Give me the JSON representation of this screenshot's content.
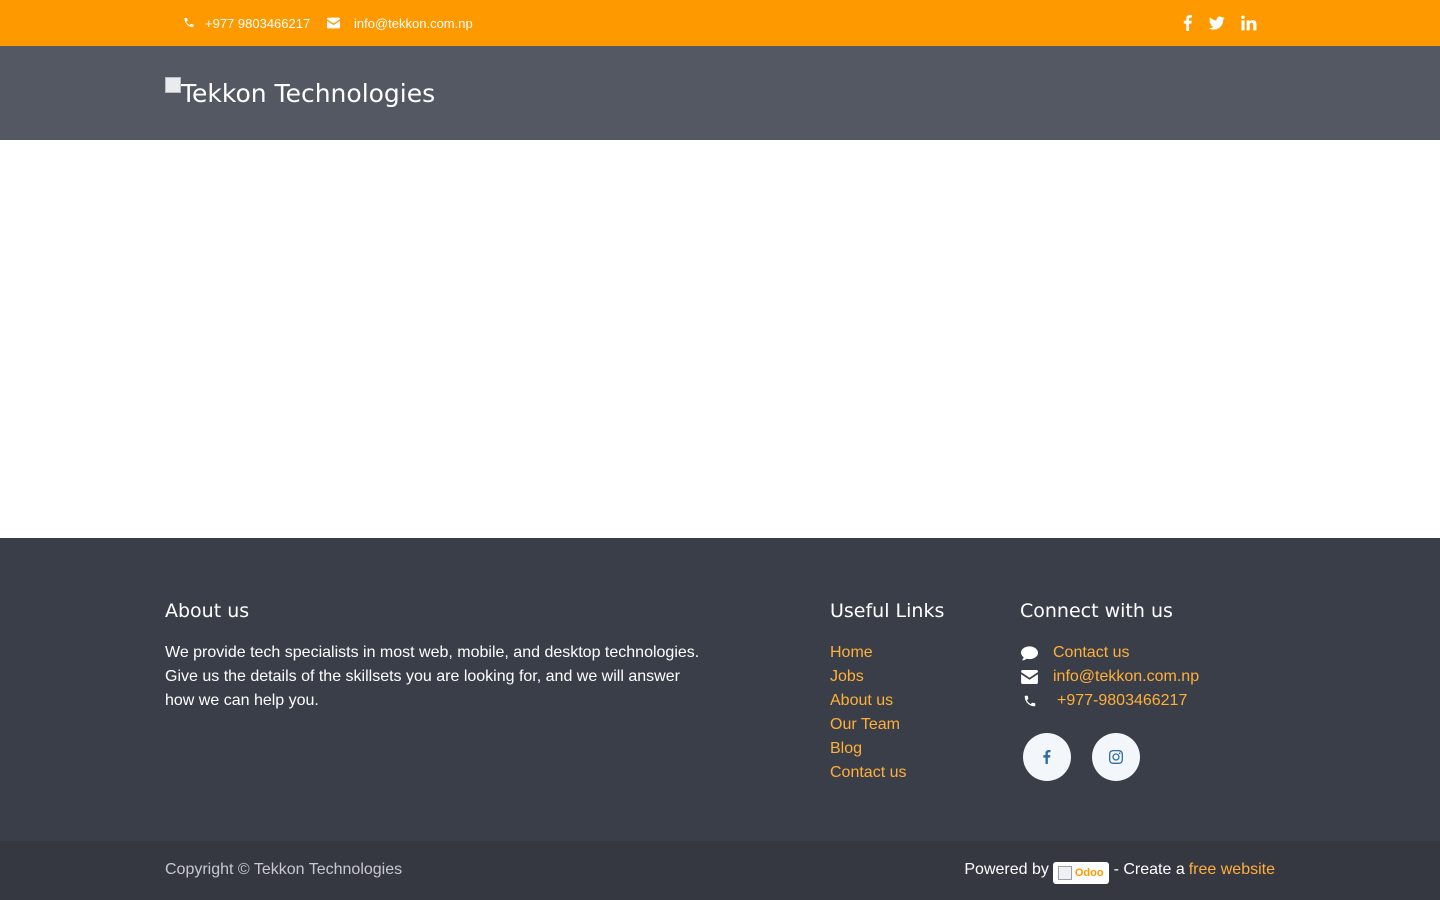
{
  "topbar": {
    "phone": "+977 9803466217",
    "email": "info@tekkon.com.np",
    "icons": [
      "phone-icon",
      "envelope-icon",
      "facebook-icon",
      "twitter-icon",
      "linkedin-icon"
    ]
  },
  "header": {
    "logo_alt": "Tekkon Technologies"
  },
  "footer": {
    "about": {
      "heading": "About us",
      "text": "We provide tech specialists in most web, mobile, and desktop technologies. Give us the details of the skillsets you are looking for, and we will answer how we can help you."
    },
    "links": {
      "heading": "Useful Links",
      "items": [
        "Home",
        "Jobs",
        "About us",
        "Our Team",
        "Blog",
        "Contact us"
      ]
    },
    "connect": {
      "heading": "Connect with us",
      "contact": "Contact us",
      "email": "info@tekkon.com.np",
      "phone": "+977-9803466217",
      "icons": [
        "comment-icon",
        "envelope-icon",
        "phone-icon",
        "facebook-icon",
        "instagram-icon"
      ]
    }
  },
  "bottombar": {
    "copyright": "Copyright © Tekkon Technologies",
    "powered_by": "Powered by",
    "odoo_alt": "Odoo",
    "create_a": "- Create a",
    "free_website": "free website"
  },
  "colors": {
    "topbar_bg": "#ff9900",
    "header_bg": "#545863",
    "footer_bg": "#3a3e48",
    "bottombar_bg": "#353841",
    "link": "#ffb03a",
    "social_icon": "#2e6da4"
  }
}
